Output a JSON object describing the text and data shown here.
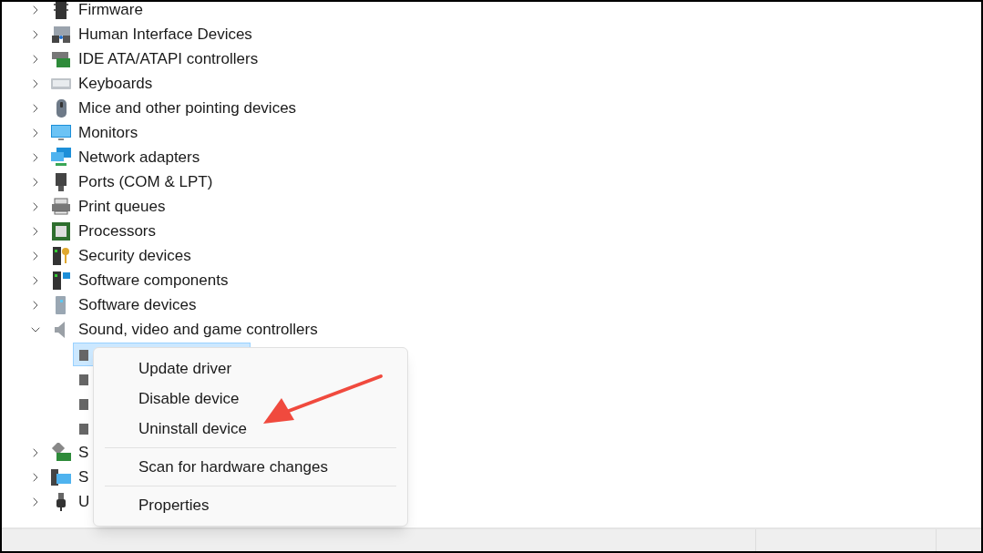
{
  "tree": {
    "items": [
      {
        "label": "Firmware",
        "expanded": false
      },
      {
        "label": "Human Interface Devices",
        "expanded": false
      },
      {
        "label": "IDE ATA/ATAPI controllers",
        "expanded": false
      },
      {
        "label": "Keyboards",
        "expanded": false
      },
      {
        "label": "Mice and other pointing devices",
        "expanded": false
      },
      {
        "label": "Monitors",
        "expanded": false
      },
      {
        "label": "Network adapters",
        "expanded": false
      },
      {
        "label": "Ports (COM & LPT)",
        "expanded": false
      },
      {
        "label": "Print queues",
        "expanded": false
      },
      {
        "label": "Processors",
        "expanded": false
      },
      {
        "label": "Security devices",
        "expanded": false
      },
      {
        "label": "Software components",
        "expanded": false
      },
      {
        "label": "Software devices",
        "expanded": false
      },
      {
        "label": "Sound, video and game controllers",
        "expanded": true,
        "children": [
          {
            "selected": true
          },
          {
            "selected": false
          },
          {
            "selected": false
          },
          {
            "selected": false
          }
        ]
      },
      {
        "label": "S",
        "expanded": false
      },
      {
        "label": "S",
        "expanded": false
      },
      {
        "label": "U",
        "expanded": false
      }
    ]
  },
  "context_menu": {
    "groups": [
      [
        "Update driver",
        "Disable device",
        "Uninstall device"
      ],
      [
        "Scan for hardware changes"
      ],
      [
        "Properties"
      ]
    ]
  }
}
